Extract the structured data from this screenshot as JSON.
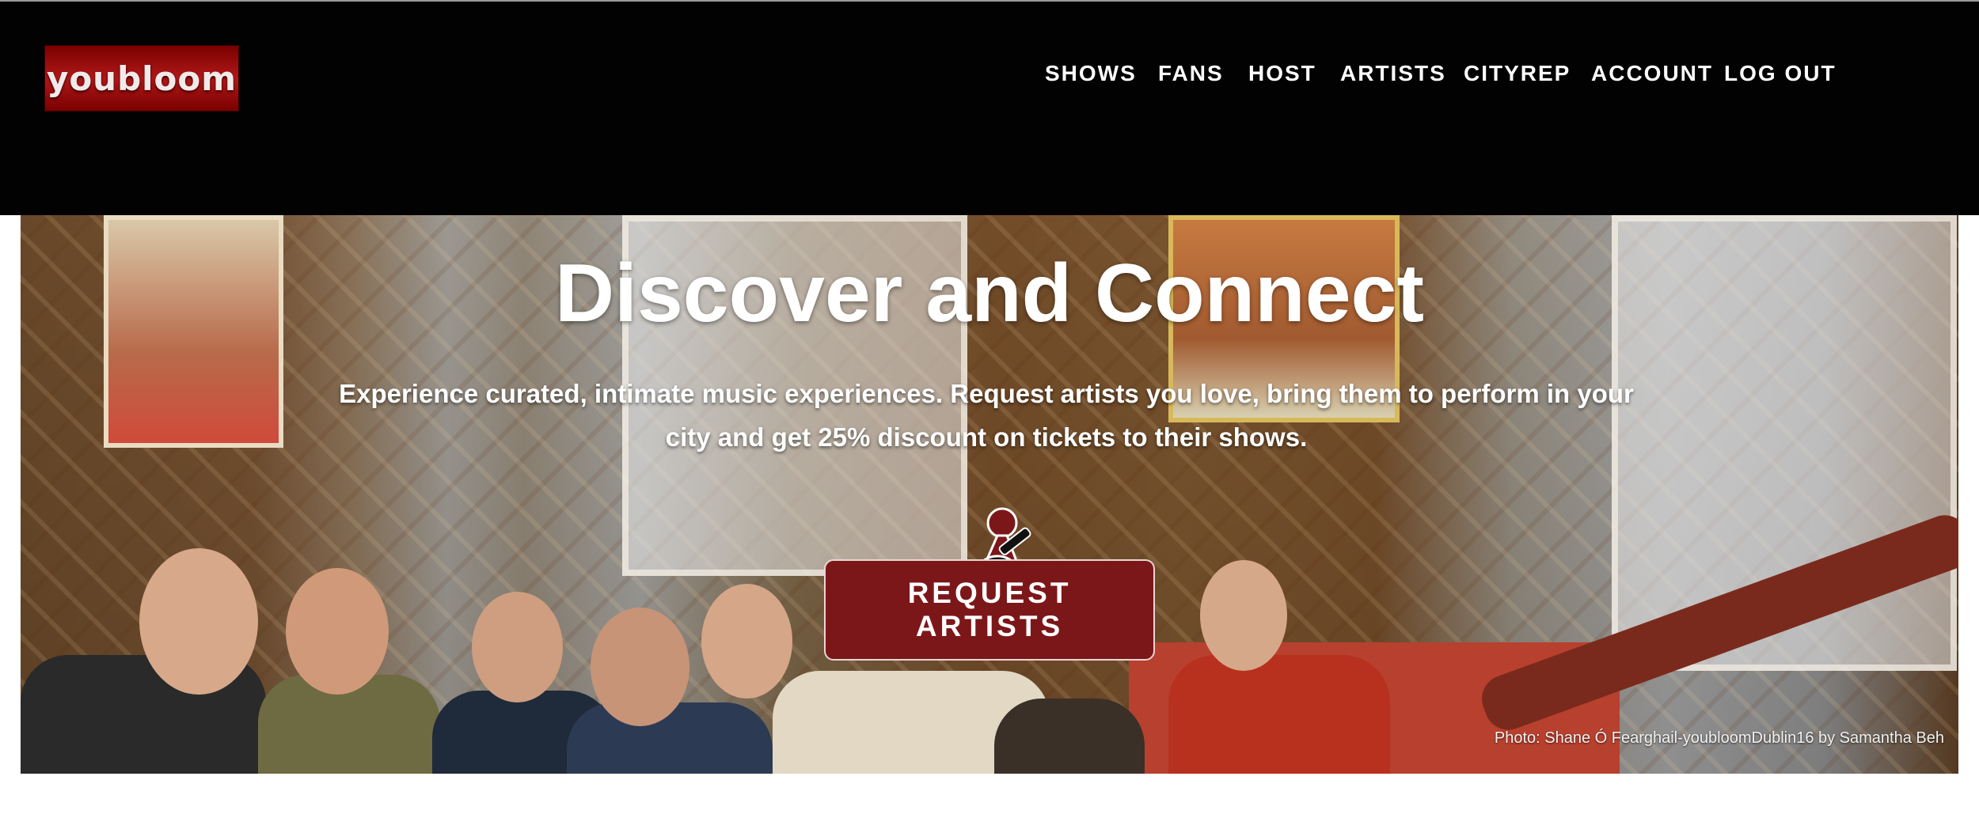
{
  "brand": {
    "logo_text": "youbloom",
    "accent": "#7c1719"
  },
  "nav": {
    "items": [
      "SHOWS",
      "FANS",
      "HOST",
      "ARTISTS",
      "CITYREP",
      "ACCOUNT",
      "LOG OUT"
    ]
  },
  "hero": {
    "title": "Discover and Connect",
    "subtitle": "Experience curated, intimate music experiences. Request artists you love, bring them to perform in your city and get 25% discount on tickets to their shows.",
    "cta_label": "REQUEST ARTISTS",
    "cta_icon": "guitar-player-icon",
    "photo_credit": "Photo: Shane Ó Fearghail-youbloomDublin16 by Samantha Beh"
  }
}
